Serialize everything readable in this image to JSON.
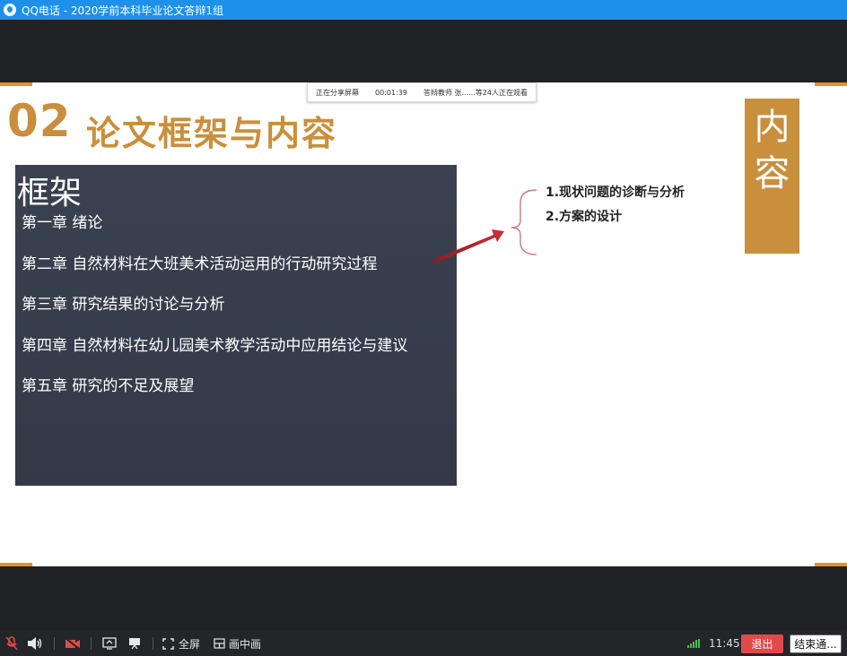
{
  "window": {
    "title": "QQ电话 - 2020学前本科毕业论文答辩1组"
  },
  "share_banner": {
    "status": "正在分享屏幕",
    "timer": "00:01:39",
    "viewers": "答辩教师 张......等24人正在观看"
  },
  "slide": {
    "number": "02",
    "title": "论文框架与内容",
    "side_tag": [
      "内",
      "容"
    ],
    "framework": {
      "heading": "框架",
      "chapters": [
        "第一章 绪论",
        "第二章 自然材料在大班美术活动运用的行动研究过程",
        "第三章 研究结果的讨论与分析",
        "第四章 自然材料在幼儿园美术教学活动中应用结论与建议",
        "第五章 研究的不足及展望"
      ]
    },
    "sub_points": [
      "1.现状问题的诊断与分析",
      "2.方案的设计"
    ],
    "colors": {
      "accent": "#c98f3c",
      "box_bg": "#3a4150",
      "arrow": "#b3202a"
    }
  },
  "toolbar": {
    "fullscreen_label": "全屏",
    "pip_label": "画中画",
    "time": "11:45",
    "leave_label": "退出",
    "end_label": "结束通..."
  }
}
